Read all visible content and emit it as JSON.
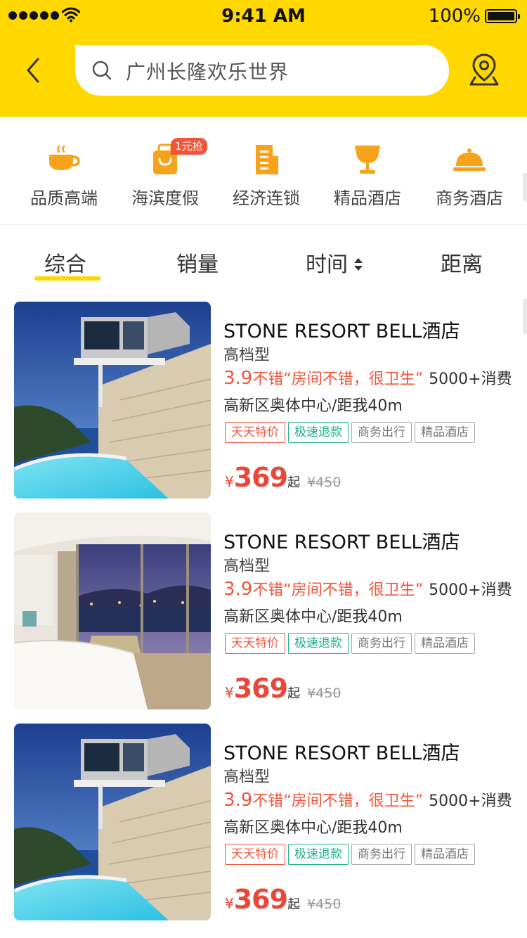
{
  "status_bar": {
    "time": "9:41 AM",
    "battery": "100%"
  },
  "search": {
    "placeholder": "广州长隆欢乐世界"
  },
  "categories": [
    {
      "label": "品质高端",
      "icon": "coffee-cup-icon"
    },
    {
      "label": "海滨度假",
      "icon": "shopping-bag-icon",
      "badge": "1元抢"
    },
    {
      "label": "经济连锁",
      "icon": "building-icon"
    },
    {
      "label": "精品酒店",
      "icon": "wine-glass-icon"
    },
    {
      "label": "商务酒店",
      "icon": "food-dome-icon"
    }
  ],
  "sort_tabs": [
    {
      "label": "综合",
      "active": true
    },
    {
      "label": "销量"
    },
    {
      "label": "时间"
    },
    {
      "label": "距离"
    }
  ],
  "hotels": [
    {
      "name": "STONE RESORT BELL酒店",
      "grade": "高档型",
      "score": "3.9",
      "comment": "不错“房间不错，很卫生”",
      "sales": "5000+消费",
      "location": "高新区奥体中心/距我40m",
      "tags": [
        "天天特价",
        "极速退款",
        "商务出行",
        "精品酒店"
      ],
      "currency": "¥",
      "price": "369",
      "price_suffix": "起",
      "original_price": "¥450",
      "image": "resort-exterior-pool"
    },
    {
      "name": "STONE RESORT BELL酒店",
      "grade": "高档型",
      "score": "3.9",
      "comment": "不错“房间不错，很卫生”",
      "sales": "5000+消费",
      "location": "高新区奥体中心/距我40m",
      "tags": [
        "天天特价",
        "极速退款",
        "商务出行",
        "精品酒店"
      ],
      "currency": "¥",
      "price": "369",
      "price_suffix": "起",
      "original_price": "¥450",
      "image": "hotel-room-night-view"
    },
    {
      "name": "STONE RESORT BELL酒店",
      "grade": "高档型",
      "score": "3.9",
      "comment": "不错“房间不错，很卫生”",
      "sales": "5000+消费",
      "location": "高新区奥体中心/距我40m",
      "tags": [
        "天天特价",
        "极速退款",
        "商务出行",
        "精品酒店"
      ],
      "currency": "¥",
      "price": "369",
      "price_suffix": "起",
      "original_price": "¥450",
      "image": "resort-exterior-pool"
    }
  ],
  "colors": {
    "brand_yellow": "#FFD800",
    "price_red": "#E8473A",
    "tag_red": "#F0553A",
    "tag_green": "#1FB38A",
    "icon_orange": "#F7A21B"
  }
}
